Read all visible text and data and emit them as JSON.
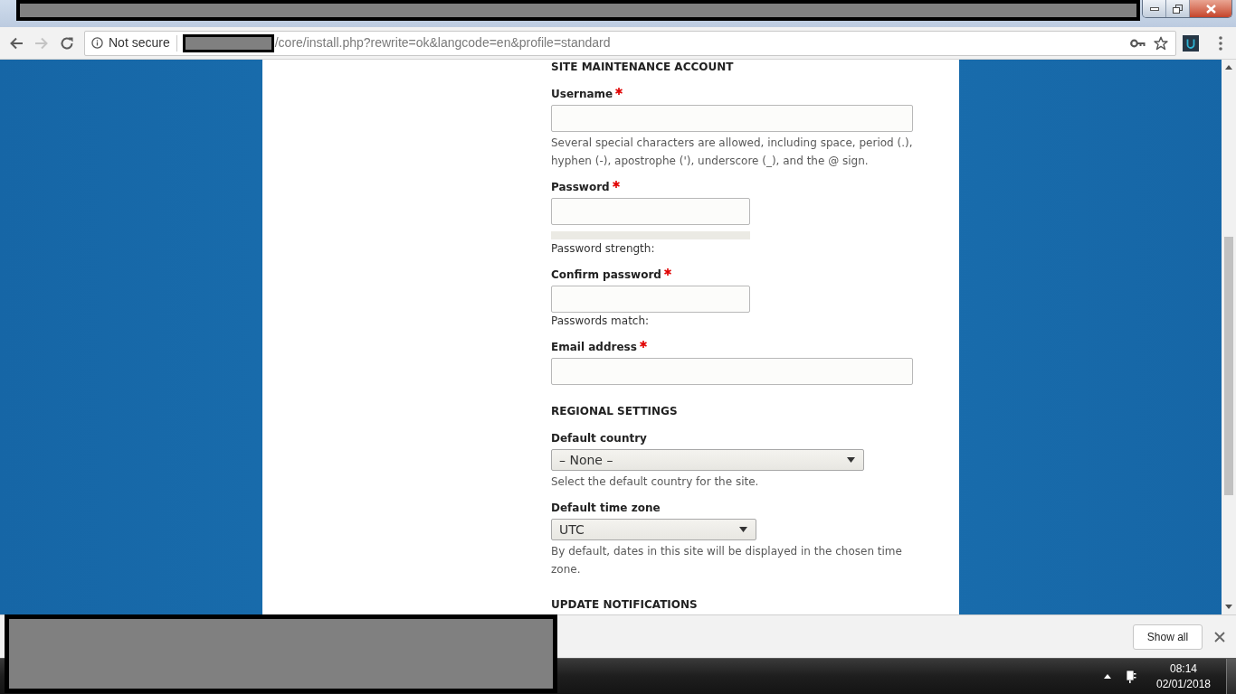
{
  "browser": {
    "nav_buttons": [
      {
        "kind": "back",
        "disabled": false
      },
      {
        "kind": "forward",
        "disabled": true
      },
      {
        "kind": "reload",
        "disabled": false
      }
    ],
    "address_bar": {
      "security_label": "Not secure",
      "url_path": "/core/install.php?rewrite=ok&langcode=en&profile=standard"
    }
  },
  "form": {
    "sections": [
      {
        "heading": "SITE MAINTENANCE ACCOUNT",
        "fields": [
          {
            "kind": "text",
            "label": "Username",
            "required": true,
            "description": "Several special characters are allowed, including space, period (.), hyphen (-), apostrophe ('), underscore (_), and the @ sign."
          },
          {
            "kind": "password",
            "label": "Password",
            "required": true,
            "meter_label": "Password strength:"
          },
          {
            "kind": "confirm",
            "label": "Confirm password",
            "required": true,
            "status_label": "Passwords match:"
          },
          {
            "kind": "email",
            "label": "Email address",
            "required": true
          }
        ]
      },
      {
        "heading": "REGIONAL SETTINGS",
        "fields": [
          {
            "kind": "select",
            "label": "Default country",
            "required": false,
            "value": "– None –",
            "description": "Select the default country for the site."
          },
          {
            "kind": "select",
            "label": "Default time zone",
            "required": false,
            "value": "UTC",
            "description": "By default, dates in this site will be displayed in the chosen time zone."
          }
        ]
      },
      {
        "heading": "UPDATE NOTIFICATIONS"
      }
    ]
  },
  "download_bar": {
    "button": "Show all"
  },
  "taskbar": {
    "time": "08:14",
    "date": "02/01/2018"
  }
}
